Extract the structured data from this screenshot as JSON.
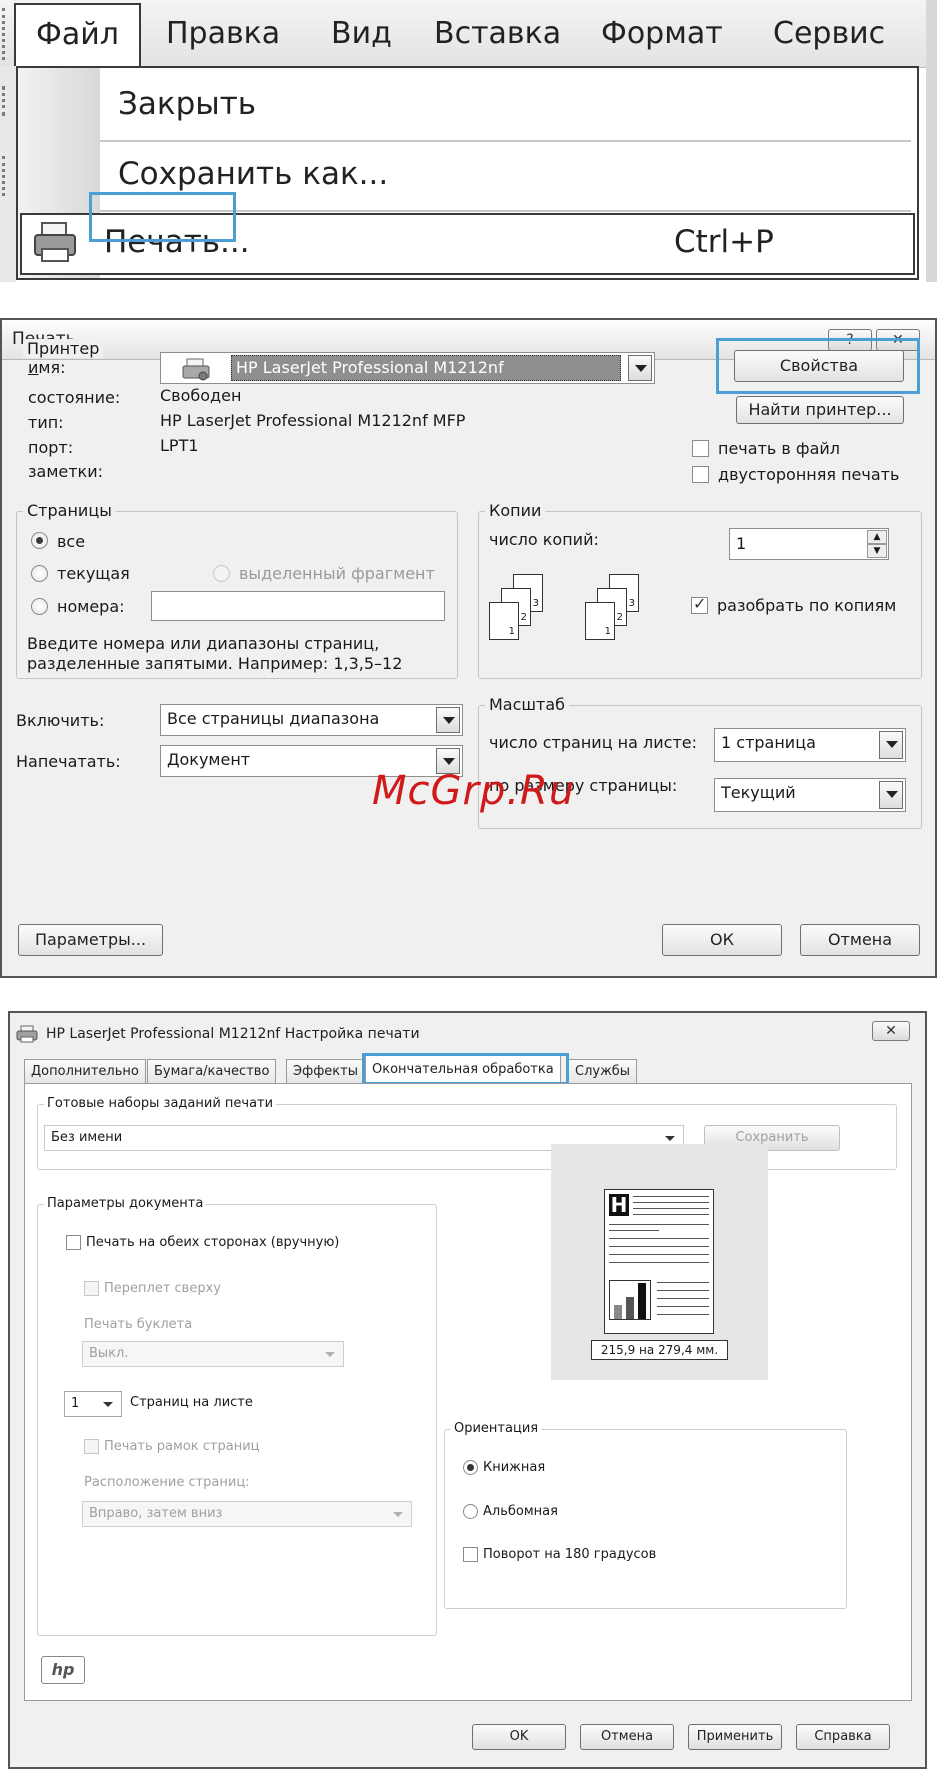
{
  "menu": {
    "bar": [
      "Файл",
      "Правка",
      "Вид",
      "Вставка",
      "Формат",
      "Сервис"
    ],
    "dropdown": {
      "close": "Закрыть",
      "save_as": "Сохранить как...",
      "print": "Печать...",
      "print_shortcut": "Ctrl+P"
    },
    "highlight_color": "#4a9fd4"
  },
  "print_dialog": {
    "title": "Печать",
    "help_glyph": "?",
    "close_glyph": "✕",
    "printer": {
      "legend": "Принтер",
      "name_label": "имя:",
      "name_value": "HP LaserJet Professional M1212nf",
      "status_label": "состояние:",
      "status_value": "Свободен",
      "type_label": "тип:",
      "type_value": "HP LaserJet Professional M1212nf MFP",
      "port_label": "порт:",
      "port_value": "LPT1",
      "notes_label": "заметки:",
      "properties_button": "Свойства",
      "find_printer_button": "Найти принтер...",
      "print_to_file": "печать в файл",
      "duplex": "двусторонняя печать"
    },
    "pages": {
      "legend": "Страницы",
      "all": "все",
      "current": "текущая",
      "selection": "выделенный фрагмент",
      "numbers": "номера:",
      "hint_line1": "Введите номера или диапазоны страниц,",
      "hint_line2": "разделенные запятыми. Например: 1,3,5–12"
    },
    "copies": {
      "legend": "Копии",
      "count_label": "число копий:",
      "count_value": "1",
      "collate": "разобрать по копиям",
      "page_labels": [
        "3",
        "2",
        "1"
      ]
    },
    "include_label": "Включить:",
    "include_value": "Все страницы диапазона",
    "print_what_label": "Напечатать:",
    "print_what_value": "Документ",
    "scale": {
      "legend": "Масштаб",
      "pages_per_sheet_label": "число страниц на листе:",
      "pages_per_sheet_value": "1 страница",
      "fit_label": "по размеру страницы:",
      "fit_value": "Текущий"
    },
    "options_button": "Параметры...",
    "ok_button": "ОК",
    "cancel_button": "Отмена",
    "watermark": "McGrp.Ru",
    "watermark_color": "#d01a1a"
  },
  "prefs_dialog": {
    "title": "HP LaserJet Professional M1212nf Настройка печати",
    "close_glyph": "✕",
    "tabs": [
      "Дополнительно",
      "Бумага/качество",
      "Эффекты",
      "Окончательная обработка",
      "Службы"
    ],
    "active_tab": "Окончательная обработка",
    "presets": {
      "legend": "Готовые наборы заданий печати",
      "value": "Без имени",
      "save_button": "Сохранить"
    },
    "doc_options": {
      "legend": "Параметры документа",
      "duplex_manual": "Печать на обеих сторонах (вручную)",
      "flip_top": "Переплет сверху",
      "booklet_label": "Печать буклета",
      "booklet_value": "Выкл.",
      "pages_per_sheet_value": "1",
      "pages_per_sheet_label": "Страниц на листе",
      "page_borders": "Печать рамок страниц",
      "page_order_label": "Расположение страниц:",
      "page_order_value": "Вправо, затем вниз"
    },
    "preview": {
      "size": "215,9 на 279,4 мм.",
      "letter": "H"
    },
    "orientation": {
      "legend": "Ориентация",
      "portrait": "Книжная",
      "landscape": "Альбомная",
      "rotate": "Поворот на 180 градусов"
    },
    "hp_logo": "hp",
    "ok_button": "OK",
    "cancel_button": "Отмена",
    "apply_button": "Применить",
    "help_button": "Справка"
  }
}
